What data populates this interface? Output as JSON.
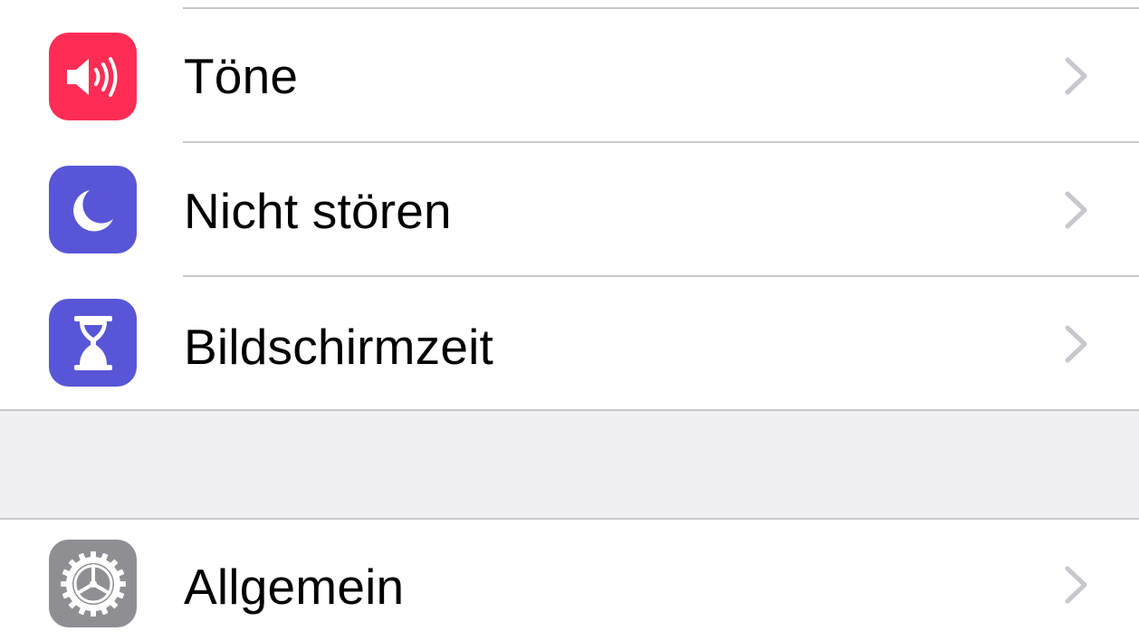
{
  "colors": {
    "sounds_icon_bg": "#ff2d55",
    "dnd_icon_bg": "#5856d6",
    "screentime_icon_bg": "#5856d6",
    "general_icon_bg": "#8e8e93",
    "separator": "#c8c7cc",
    "group_gap_bg": "#efeff4",
    "chevron": "#c7c7cc"
  },
  "settings": {
    "group1": [
      {
        "id": "sounds",
        "label": "Töne",
        "icon": "speaker-icon"
      },
      {
        "id": "do-not-disturb",
        "label": "Nicht stören",
        "icon": "moon-icon"
      },
      {
        "id": "screen-time",
        "label": "Bildschirmzeit",
        "icon": "hourglass-icon"
      }
    ],
    "group2": [
      {
        "id": "general",
        "label": "Allgemein",
        "icon": "gear-icon"
      }
    ]
  }
}
